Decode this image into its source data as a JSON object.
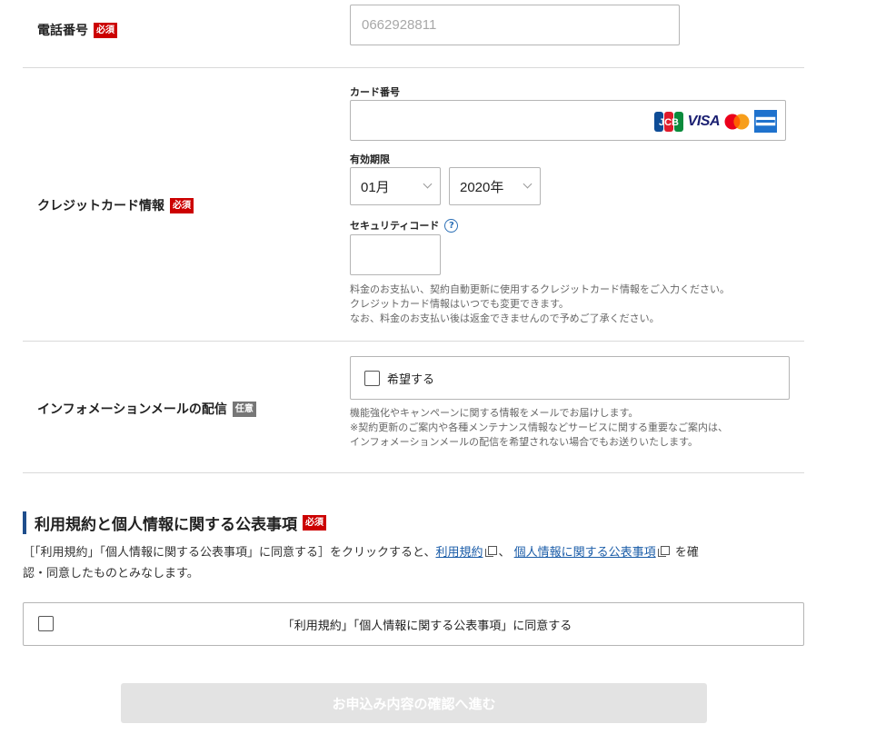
{
  "badges": {
    "required": "必須",
    "optional": "任意"
  },
  "phone": {
    "label": "電話番号",
    "placeholder": "0662928811"
  },
  "credit_card": {
    "label": "クレジットカード情報",
    "card_number_label": "カード番号",
    "card_number_value": "",
    "brands": [
      "JCB",
      "VISA",
      "Mastercard",
      "American Express"
    ],
    "visa_text": "VISA",
    "jcb_text": "JCB",
    "expiry_label": "有効期限",
    "month_selected": "01月",
    "year_selected": "2020年",
    "security_code_label": "セキュリティコード",
    "help_icon_glyph": "?",
    "notes": [
      "料金のお支払い、契約自動更新に使用するクレジットカード情報をご入力ください。",
      "クレジットカード情報はいつでも変更できます。",
      "なお、料金のお支払い後は返金できませんので予めご了承ください。"
    ]
  },
  "info_mail": {
    "label": "インフォメーションメールの配信",
    "checkbox_label": "希望する",
    "notes": [
      "機能強化やキャンペーンに関する情報をメールでお届けします。",
      "※契約更新のご案内や各種メンテナンス情報などサービスに関する重要なご案内は、",
      "インフォメーションメールの配信を希望されない場合でもお送りいたします。"
    ]
  },
  "terms": {
    "title": "利用規約と個人情報に関する公表事項",
    "para_prefix": "［「利用規約」「個人情報に関する公表事項」に同意する］をクリックすると、",
    "link_terms": "利用規約",
    "separator": "、",
    "link_privacy": "個人情報に関する公表事項",
    "para_suffix_1": "を確",
    "para_line2": "認・同意したものとみなします。",
    "agree_label": "「利用規約」「個人情報に関する公表事項」に同意する"
  },
  "submit": {
    "label": "お申込み内容の確認へ進む"
  },
  "colors": {
    "required_badge": "#cc0000",
    "optional_badge": "#777777",
    "section_accent": "#1f4e8c",
    "link": "#1a5ca8",
    "submit_disabled_bg": "#e3e3e3"
  }
}
